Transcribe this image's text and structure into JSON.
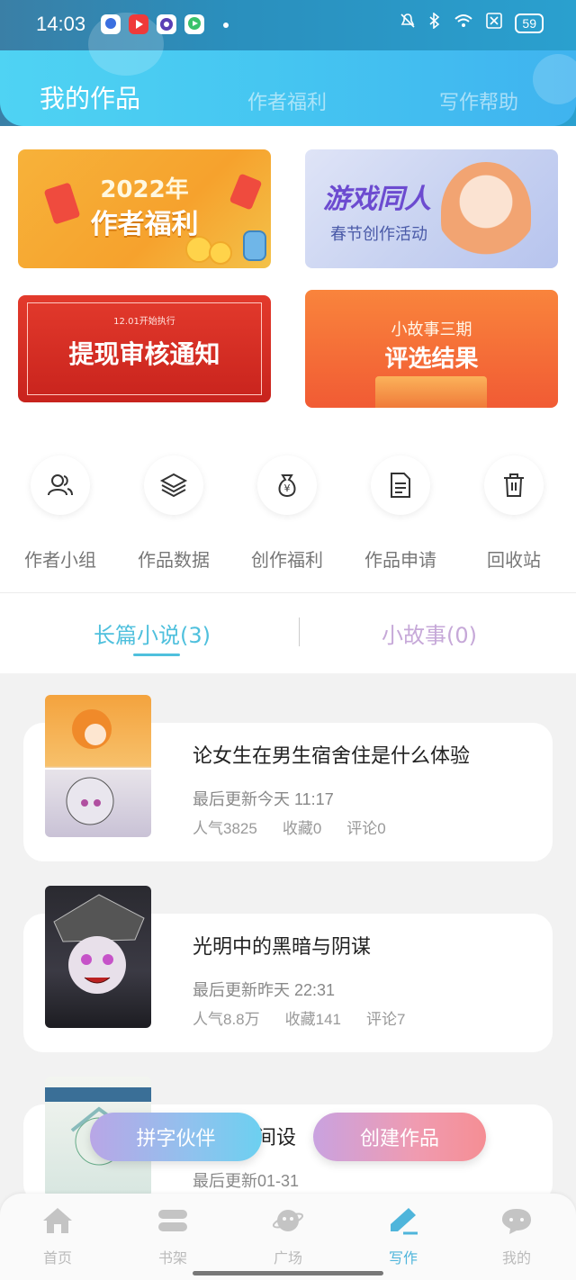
{
  "status_bar": {
    "time": "14:03",
    "battery": "59",
    "icons": [
      "baidu-app-icon",
      "video-app-icon",
      "purple-app-icon",
      "green-app-icon",
      "mute-icon",
      "bluetooth-icon",
      "wifi-icon",
      "close-box-icon"
    ]
  },
  "header": {
    "tabs": [
      {
        "label": "我的作品",
        "active": true
      },
      {
        "label": "作者福利",
        "active": false
      },
      {
        "label": "写作帮助",
        "active": false
      }
    ]
  },
  "banners": [
    {
      "year": "2022年",
      "title": "作者福利"
    },
    {
      "title": "游戏同人",
      "subtitle": "春节创作活动"
    },
    {
      "small": "12.01开始执行",
      "title": "提现审核通知"
    },
    {
      "pre": "小故事三期",
      "title": "评选结果"
    }
  ],
  "actions": [
    {
      "label": "作者小组",
      "icon": "users-icon"
    },
    {
      "label": "作品数据",
      "icon": "layers-icon"
    },
    {
      "label": "创作福利",
      "icon": "money-bag-icon"
    },
    {
      "label": "作品申请",
      "icon": "document-icon"
    },
    {
      "label": "回收站",
      "icon": "trash-icon"
    }
  ],
  "type_tabs": [
    {
      "label": "长篇小说(3)",
      "active": true
    },
    {
      "label": "小故事(0)",
      "active": false
    }
  ],
  "works": [
    {
      "title": "论女生在男生宿舍住是什么体验",
      "updated": "最后更新今天 11:17",
      "popularity": "人气3825",
      "favorites": "收藏0",
      "comments": "评论0"
    },
    {
      "title": "光明中的黑暗与阴谋",
      "updated": "最后更新昨天 22:31",
      "popularity": "人气8.8万",
      "favorites": "收藏141",
      "comments": "评论7"
    },
    {
      "title_partial": "间设",
      "updated": "最后更新01-31"
    }
  ],
  "float_buttons": {
    "partner": "拼字伙伴",
    "create": "创建作品"
  },
  "bottom_nav": [
    {
      "label": "首页",
      "icon": "home-icon",
      "active": false
    },
    {
      "label": "书架",
      "icon": "bookshelf-icon",
      "active": false
    },
    {
      "label": "广场",
      "icon": "planet-icon",
      "active": false
    },
    {
      "label": "写作",
      "icon": "pen-icon",
      "active": true
    },
    {
      "label": "我的",
      "icon": "chat-bubble-icon",
      "active": false
    }
  ],
  "colors": {
    "accent": "#4fc0dd",
    "header_gradient_start": "#4fd3f3",
    "header_gradient_end": "#3fb3ef"
  }
}
